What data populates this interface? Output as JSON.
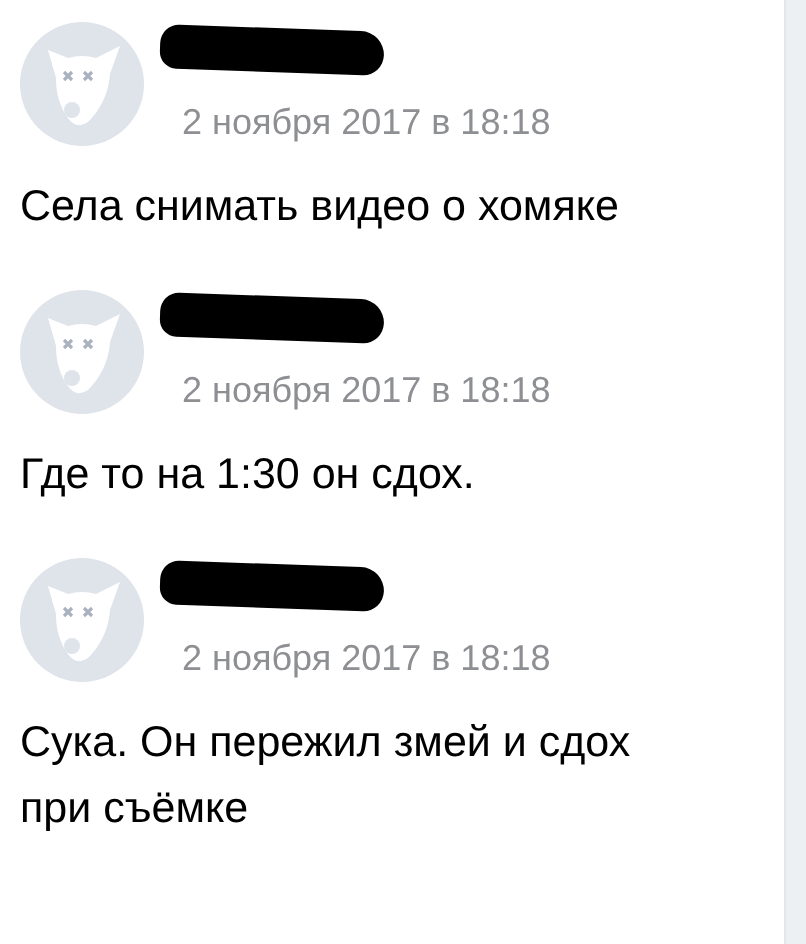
{
  "comments": [
    {
      "date": "2 ноября 2017 в 18:18",
      "text": "Села снимать видео о хомяке"
    },
    {
      "date": "2 ноября 2017 в 18:18",
      "text": "Где то на 1:30 он сдох."
    },
    {
      "date": "2 ноября 2017 в 18:18",
      "text": "Сука. Он пережил змей и сдох при съёмке"
    }
  ]
}
